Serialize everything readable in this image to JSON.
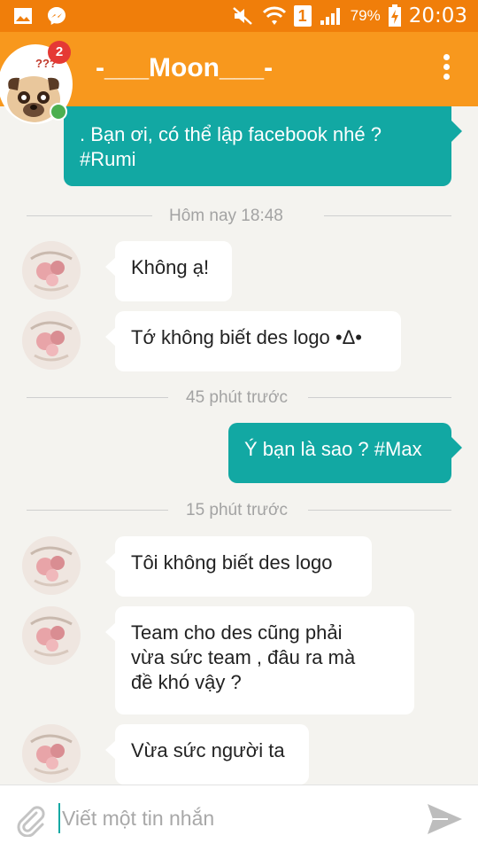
{
  "status_bar": {
    "battery_percent": "79%",
    "time": "20:03",
    "sim_label": "1",
    "icons": [
      "gallery-icon",
      "messenger-icon",
      "mute-icon",
      "wifi-icon",
      "sim-icon",
      "signal-icon",
      "battery-charging-icon"
    ]
  },
  "header": {
    "contact_name": "-___Moon___-",
    "unread_badge": "2",
    "online": true,
    "avatar_caption": "???"
  },
  "messages": [
    {
      "kind": "out",
      "text_lines": [
        ". Bạn ơi, có thể lập facebook nhé ?",
        "#Rumi"
      ]
    },
    {
      "kind": "separator",
      "text": "Hôm nay 18:48"
    },
    {
      "kind": "in",
      "text_lines": [
        "Không ạ!"
      ]
    },
    {
      "kind": "in",
      "text_lines": [
        "Tớ không biết des logo •Δ•"
      ]
    },
    {
      "kind": "separator",
      "text": "45 phút trước"
    },
    {
      "kind": "out",
      "text_lines": [
        "Ý bạn là sao ? #Max"
      ]
    },
    {
      "kind": "separator",
      "text": "15 phút trước"
    },
    {
      "kind": "in",
      "text_lines": [
        "Tôi không biết des logo"
      ]
    },
    {
      "kind": "in",
      "text_lines": [
        "Team cho des cũng phải",
        "vừa sức team , đâu ra mà",
        "đề khó vậy ?"
      ]
    },
    {
      "kind": "in",
      "text_lines": [
        "Vừa sức người ta"
      ]
    }
  ],
  "composer": {
    "placeholder": "Viết một tin nhắn",
    "value": ""
  },
  "colors": {
    "status_bar": "#f07e0a",
    "app_bar": "#f8981d",
    "outgoing_bubble": "#12a8a3",
    "incoming_bubble": "#ffffff",
    "background": "#f4f3ef",
    "online": "#4caf50",
    "badge": "#e53935"
  }
}
